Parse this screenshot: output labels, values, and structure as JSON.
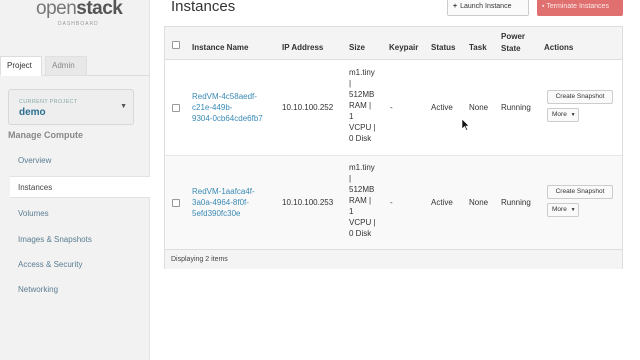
{
  "logo": {
    "brand_light": "open",
    "brand_bold": "stack",
    "sub": "DASHBOARD"
  },
  "sidebar": {
    "tabs": [
      {
        "label": "Project"
      },
      {
        "label": "Admin"
      }
    ],
    "current_project": {
      "label": "CURRENT PROJECT",
      "name": "demo"
    },
    "section": "Manage Compute",
    "items": [
      {
        "label": "Overview"
      },
      {
        "label": "Instances"
      },
      {
        "label": "Volumes"
      },
      {
        "label": "Images & Snapshots"
      },
      {
        "label": "Access & Security"
      },
      {
        "label": "Networking"
      }
    ]
  },
  "header": {
    "title": "Instances",
    "launch_label": "Launch Instance",
    "terminate_label": "Terminate Instances"
  },
  "table": {
    "columns": [
      "Instance Name",
      "IP Address",
      "Size",
      "Keypair",
      "Status",
      "Task",
      "Power State",
      "Actions"
    ],
    "power_state_lines": [
      "Power",
      "State"
    ],
    "rows": [
      {
        "name_lines": [
          "RedVM-4c58aedf-",
          "c21e-449b-",
          "9304-0cb64cde6fb7"
        ],
        "ip": "10.10.100.252",
        "size_lines": [
          "m1.tiny",
          "|",
          "512MB",
          "RAM |",
          "1",
          "VCPU |",
          "0 Disk"
        ],
        "keypair": "-",
        "status": "Active",
        "task": "None",
        "power": "Running",
        "snapshot_label": "Create Snapshot",
        "more_label": "More"
      },
      {
        "name_lines": [
          "RedVM-1aafca4f-",
          "3a0a-4964-8f0f-",
          "5efd390fc30e"
        ],
        "ip": "10.10.100.253",
        "size_lines": [
          "m1.tiny",
          "|",
          "512MB",
          "RAM |",
          "1",
          "VCPU |",
          "0 Disk"
        ],
        "keypair": "-",
        "status": "Active",
        "task": "None",
        "power": "Running",
        "snapshot_label": "Create Snapshot",
        "more_label": "More"
      }
    ],
    "footer": "Displaying 2 items"
  },
  "colors": {
    "link": "#3a8ab5",
    "danger": "#e07070",
    "sidebar_bg": "#f2f2f2"
  }
}
